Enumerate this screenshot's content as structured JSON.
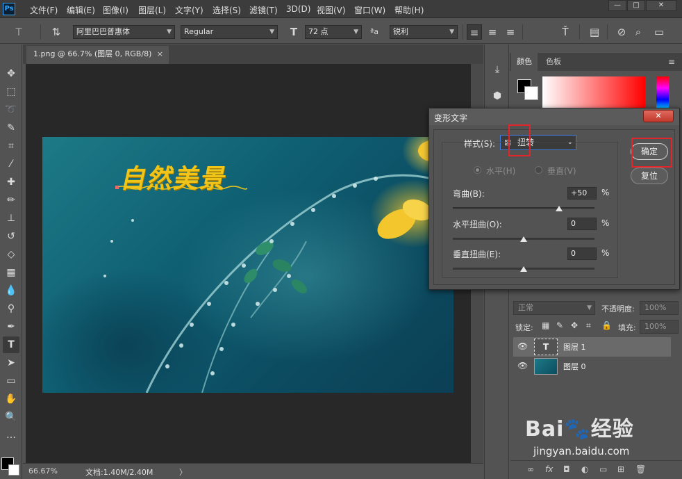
{
  "menubar": {
    "app_icon": "Ps",
    "items": [
      "文件(F)",
      "编辑(E)",
      "图像(I)",
      "图层(L)",
      "文字(Y)",
      "选择(S)",
      "滤镜(T)",
      "3D(D)",
      "视图(V)",
      "窗口(W)",
      "帮助(H)"
    ],
    "window_buttons": [
      "—",
      "□",
      "✕"
    ]
  },
  "options": {
    "font_family": "阿里巴巴普惠体",
    "font_style": "Regular",
    "font_size": "72 点",
    "aa_label": "ªa",
    "antialias": "锐利",
    "text_color": "#f5c32c"
  },
  "document": {
    "tab_title": "1.png @ 66.7% (图层 0, RGB/8)",
    "tab_close": "×",
    "warped_text": "自然美景",
    "status_zoom": "66.67%",
    "status_doc": "文档:1.40M/2.40M",
    "status_arrow": "〉"
  },
  "color_panel": {
    "tabs": [
      "颜色",
      "色板"
    ]
  },
  "layers_panel": {
    "blend_mode": "正常",
    "opacity_label": "不透明度:",
    "opacity_value": "100%",
    "lock_label": "锁定:",
    "fill_label": "填充:",
    "fill_value": "100%",
    "layers": [
      {
        "name": "图层 1",
        "thumb": "T",
        "selected": true
      },
      {
        "name": "图层 0",
        "thumb": "",
        "selected": false
      }
    ],
    "bottom_icons": [
      "∞",
      "fx",
      "◘",
      "◐",
      "▭",
      "⊞",
      "🗑"
    ]
  },
  "dialog": {
    "title": "变形文字",
    "close": "✕",
    "style_label": "样式(S):",
    "style_value": "扭转",
    "horizontal_label": "水平(H)",
    "vertical_label": "垂直(V)",
    "bend_label": "弯曲(B):",
    "bend_value": "+50",
    "bend_fraction": 0.75,
    "hdistort_label": "水平扭曲(O):",
    "hdistort_value": "0",
    "hdistort_fraction": 0.5,
    "vdistort_label": "垂直扭曲(E):",
    "vdistort_value": "0",
    "vdistort_fraction": 0.5,
    "percent": "%",
    "ok_label": "确定",
    "reset_label": "复位"
  },
  "watermark": {
    "logo": "Bai🐾经验",
    "url": "jingyan.baidu.com"
  }
}
